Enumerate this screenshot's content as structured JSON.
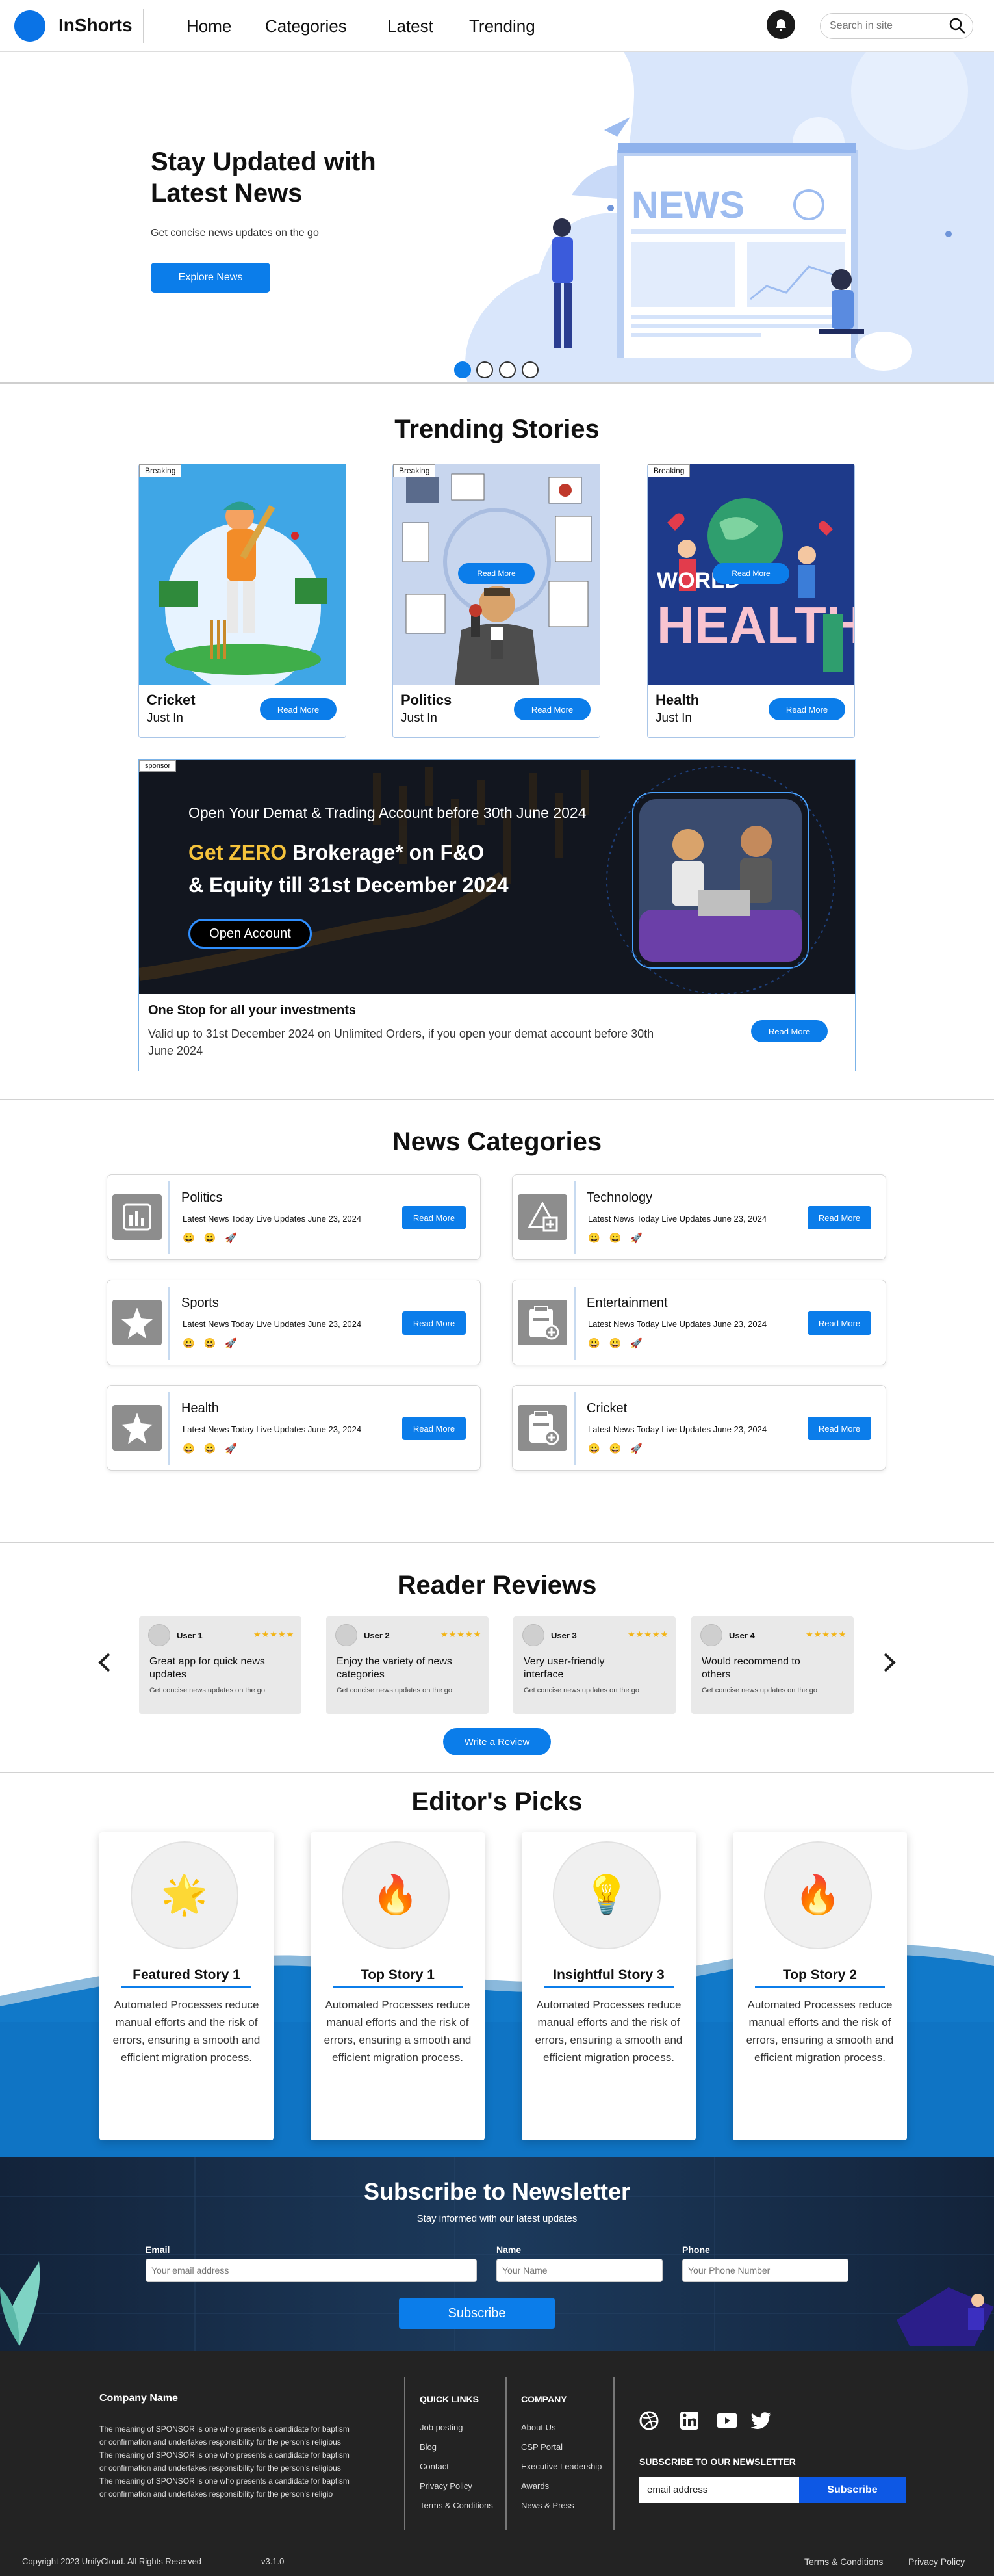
{
  "nav": {
    "brand": "InShorts",
    "links": [
      "Home",
      "Categories",
      "Latest",
      "Trending"
    ],
    "search_placeholder": "Search in site"
  },
  "hero": {
    "title": "Stay Updated with Latest News",
    "subtitle": "Get concise news updates on the go",
    "button": "Explore News",
    "illustration_word": "NEWS",
    "slides": 4,
    "active_slide": 1
  },
  "trending": {
    "title": "Trending Stories",
    "cards": [
      {
        "tag": "Breaking",
        "name": "Cricket",
        "sub": "Just In",
        "button": "Read More"
      },
      {
        "tag": "Breaking",
        "name": "Politics",
        "sub": "Just In",
        "button": "Read More",
        "overlay_button": "Read More"
      },
      {
        "tag": "Breaking",
        "name": "Health",
        "sub": "Just In",
        "button": "Read More",
        "overlay_button": "Read More",
        "art_text_1": "WORLD",
        "art_text_2": "HEALTH"
      }
    ]
  },
  "ad": {
    "tag": "sponsor",
    "line1": "Open Your Demat & Trading Account before 30th June 2024",
    "hl_yellow": "Get ZERO",
    "hl_white": " Brokerage* on F&O",
    "line3": "& Equity till 31st December 2024",
    "cta": "Open Account",
    "title": "One Stop for all your investments",
    "desc": "Valid up to 31st December 2024 on Unlimited Orders, if you open your demat account before 30th June 2024",
    "button": "Read More"
  },
  "categories": {
    "title": "News Categories",
    "items": [
      {
        "name": "Politics",
        "sub": "Latest News Today Live Updates June 23, 2024",
        "button": "Read More",
        "icon": "bar-chart-icon"
      },
      {
        "name": "Technology",
        "sub": "Latest News Today Live Updates June 23, 2024",
        "button": "Read More",
        "icon": "shapes-icon"
      },
      {
        "name": "Sports",
        "sub": "Latest News Today Live Updates June 23, 2024",
        "button": "Read More",
        "icon": "star-icon"
      },
      {
        "name": "Entertainment",
        "sub": "Latest News Today Live Updates June 23, 2024",
        "button": "Read More",
        "icon": "clipboard-icon"
      },
      {
        "name": "Health",
        "sub": "Latest News Today Live Updates June 23, 2024",
        "button": "Read More",
        "icon": "star-icon"
      },
      {
        "name": "Cricket",
        "sub": "Latest News Today Live Updates June 23, 2024",
        "button": "Read More",
        "icon": "clipboard-icon"
      }
    ],
    "reactions": "😀😀🚀"
  },
  "reviews": {
    "title": "Reader Reviews",
    "items": [
      {
        "user": "User 1",
        "stars": "★★★★★",
        "text": "Great app for quick news updates",
        "sub": "Get concise news updates on the go"
      },
      {
        "user": "User 2",
        "stars": "★★★★★",
        "text": "Enjoy the variety of news categories",
        "sub": "Get concise news updates on the go"
      },
      {
        "user": "User 3",
        "stars": "★★★★★",
        "text": "Very user-friendly interface",
        "sub": "Get concise news updates on the go"
      },
      {
        "user": "User 4",
        "stars": "★★★★★",
        "text": "Would recommend to others",
        "sub": "Get concise news updates on the go"
      }
    ],
    "button": "Write a Review"
  },
  "picks": {
    "title": "Editor's Picks",
    "items": [
      {
        "title": "Featured Story 1",
        "icon": "🌟",
        "desc": "Automated Processes reduce manual efforts and the risk of errors, ensuring a smooth and efficient migration process."
      },
      {
        "title": "Top Story 1",
        "icon": "🔥",
        "desc": "Automated Processes reduce manual efforts and the risk of errors, ensuring a smooth and efficient migration process."
      },
      {
        "title": "Insightful Story 3",
        "icon": "💡",
        "desc": "Automated Processes reduce manual efforts and the risk of errors, ensuring a smooth and efficient migration process."
      },
      {
        "title": "Top Story 2",
        "icon": "🔥",
        "desc": "Automated Processes reduce manual efforts and the risk of errors, ensuring a smooth and efficient migration process."
      }
    ]
  },
  "newsletter": {
    "title": "Subscribe to Newsletter",
    "subtitle": "Stay informed with our latest updates",
    "email_label": "Email",
    "email_placeholder": "Your email address",
    "name_label": "Name",
    "name_placeholder": "Your Name",
    "phone_label": "Phone",
    "phone_placeholder": "Your Phone Number",
    "button": "Subscribe"
  },
  "footer": {
    "company_name": "Company Name",
    "about_lines": [
      "The meaning of SPONSOR is one who presents a candidate for baptism",
      "or confirmation and undertakes responsibility for the person's religious",
      "The meaning of SPONSOR is one who presents a candidate for baptism",
      "or confirmation and undertakes responsibility for the person's religious",
      "The meaning of SPONSOR is one who presents a candidate for baptism",
      "or confirmation and undertakes responsibility for the person's religio"
    ],
    "quick_links_title": "QUICK LINKS",
    "quick_links": [
      "Job posting",
      "Blog",
      "Contact",
      "Privacy Policy",
      "Terms & Conditions"
    ],
    "company_title": "COMPANY",
    "company_links": [
      "About Us",
      "CSP Portal",
      "Executive Leadership",
      "Awards",
      "News & Press"
    ],
    "subscribe_title": "SUBSCRIBE TO OUR NEWSLETTER",
    "email_value": "email address",
    "subscribe_button": "Subscribe",
    "copyright": "Copyright 2023 UnifyCloud. All Rights Reserved",
    "version": "v3.1.0",
    "bottom_links": [
      "Terms & Conditions",
      "Privacy Policy"
    ]
  }
}
